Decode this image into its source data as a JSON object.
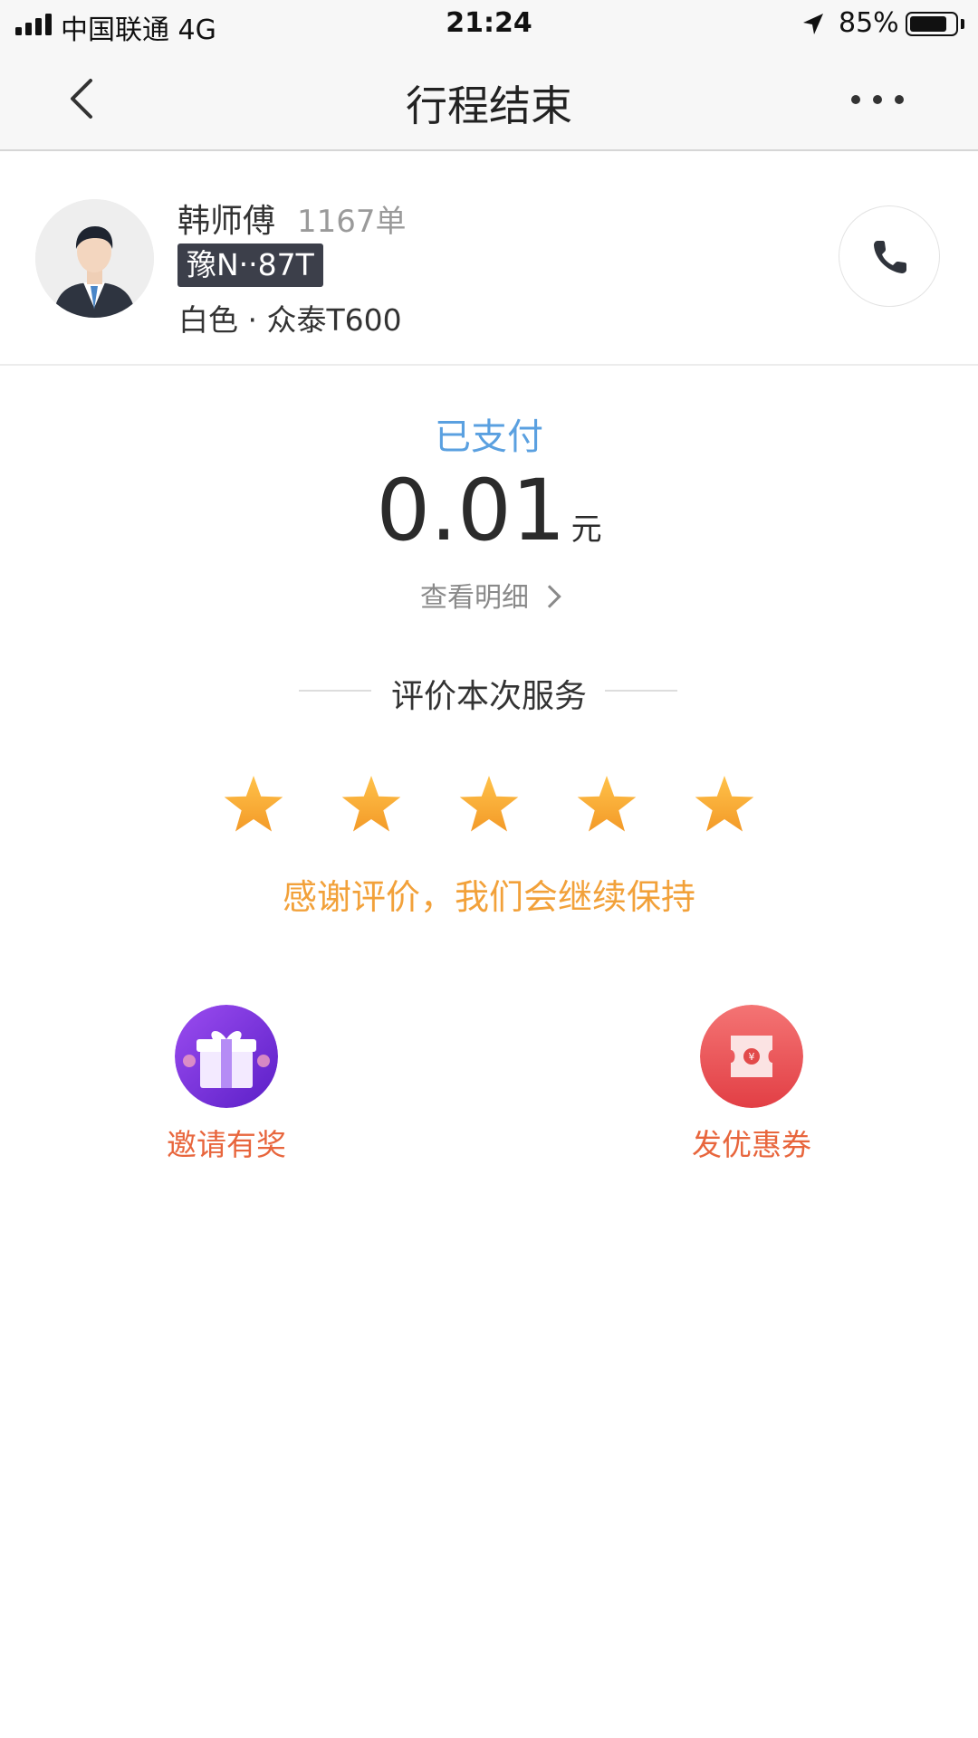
{
  "status_bar": {
    "carrier": "中国联通   4G",
    "time": "21:24",
    "battery": "85%",
    "battery_level": 0.85,
    "signal_bars": 4
  },
  "nav": {
    "title": "行程结束",
    "back_icon": "chevron-left-icon",
    "more_icon": "more-dots-icon"
  },
  "driver": {
    "name": "韩师傅",
    "orders": "1167单",
    "plate": "豫N‧‧87T",
    "car": "白色 · 众泰T600",
    "call_icon": "phone-icon"
  },
  "payment": {
    "status": "已支付",
    "amount": "0.01",
    "currency": "元",
    "detail_label": "查看明细"
  },
  "rating": {
    "title": "评价本次服务",
    "stars": 5,
    "star_total": 5,
    "thanks": "感谢评价，我们会继续保持"
  },
  "actions": [
    {
      "label": "邀请有奖",
      "icon": "gift-icon"
    },
    {
      "label": "发优惠券",
      "icon": "coupon-icon"
    }
  ],
  "colors": {
    "accent_blue": "#5aa0e0",
    "star_orange": "#f2a13a",
    "action_label": "#e8663d",
    "gift_purple": "#7b2ee0",
    "coupon_red": "#ea4f4f"
  }
}
